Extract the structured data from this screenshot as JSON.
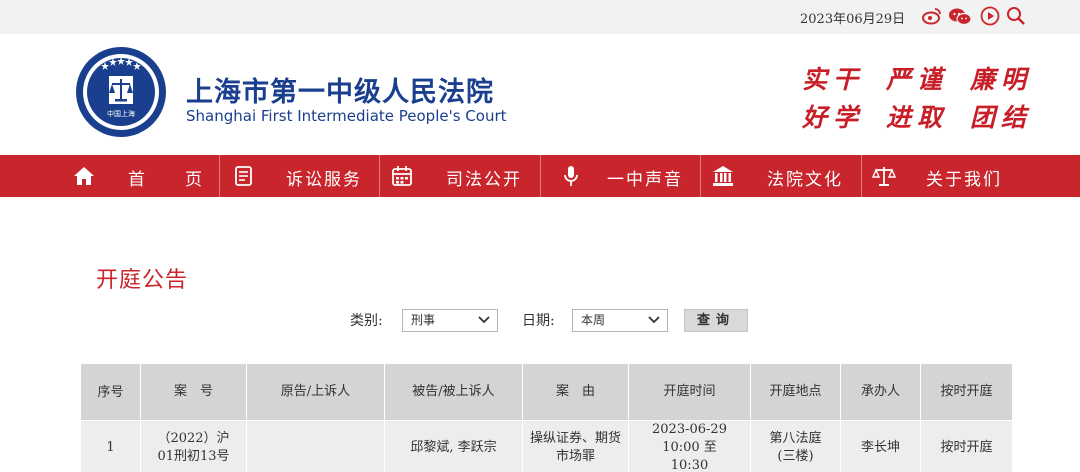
{
  "topbar": {
    "date": "2023年06月29日",
    "icons": [
      "weibo-icon",
      "wechat-icon",
      "play-icon",
      "search-icon"
    ]
  },
  "header": {
    "logo_text": "中国上海",
    "logo_ring_text": "上海市第一中级人民法院",
    "title_cn": "上海市第一中级人民法院",
    "title_en": "Shanghai First Intermediate People's Court",
    "motto": [
      "实干",
      "严谨",
      "廉明",
      "好学",
      "进取",
      "团结"
    ]
  },
  "nav": {
    "items": [
      {
        "label": "首　　页",
        "icon": "home-icon"
      },
      {
        "label": "诉讼服务",
        "icon": "document-icon"
      },
      {
        "label": "司法公开",
        "icon": "calendar-icon"
      },
      {
        "label": "一中声音",
        "icon": "microphone-icon"
      },
      {
        "label": "法院文化",
        "icon": "courthouse-icon"
      },
      {
        "label": "关于我们",
        "icon": "scales-icon"
      }
    ]
  },
  "main": {
    "title": "开庭公告",
    "filter": {
      "category_label": "类别:",
      "category_value": "刑事",
      "date_label": "日期:",
      "date_value": "本周",
      "query_label": "查询"
    },
    "table": {
      "headers": [
        "序号",
        "案　号",
        "原告/上诉人",
        "被告/被上诉人",
        "案　由",
        "开庭时间",
        "开庭地点",
        "承办人",
        "按时开庭"
      ],
      "rows": [
        {
          "index": "1",
          "case_no": "（2022）沪01刑初13号",
          "plaintiff": "",
          "defendant": "邱黎斌, 李跃宗",
          "cause": "操纵证券、期货市场罪",
          "time": "2023-06-29 10:00 至 10:30",
          "location": "第八法庭(三楼)",
          "judge": "李长坤",
          "on_time": "按时开庭"
        }
      ]
    }
  },
  "colors": {
    "brand_red": "#c8252c",
    "brand_blue": "#1b3f8f"
  }
}
